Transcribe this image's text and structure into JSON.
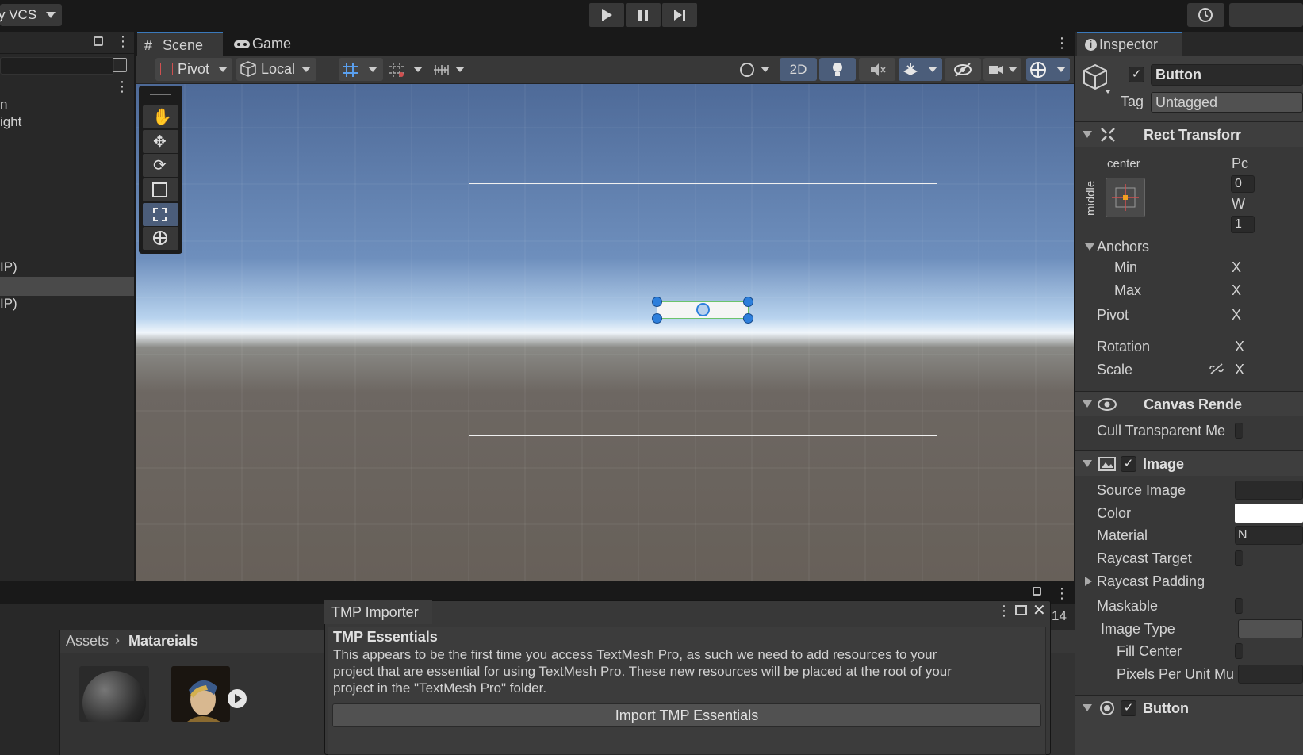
{
  "toolbar": {
    "vcs_label": "y VCS",
    "play": "play-icon",
    "pause": "pause-icon",
    "step": "step-icon"
  },
  "hierarchy": {
    "items": [
      {
        "text": "n"
      },
      {
        "text": "ight"
      },
      {
        "text": "IP)"
      },
      {
        "text": ""
      },
      {
        "text": "IP)"
      }
    ]
  },
  "scene": {
    "tabs": [
      {
        "label": "Scene",
        "icon": "hash-icon"
      },
      {
        "label": "Game",
        "icon": "gamepad-icon"
      }
    ],
    "toolbar": {
      "pivot": "Pivot",
      "local": "Local",
      "mode_2d": "2D"
    }
  },
  "inspector": {
    "tab_label": "Inspector",
    "object_name": "Button",
    "tag_label": "Tag",
    "tag_value": "Untagged",
    "rect_transform": {
      "title": "Rect Transforr",
      "anchor_h": "center",
      "anchor_v": "middle",
      "pos_label_fragment": "Pc",
      "pos_value_fragment": "0",
      "w_label_fragment": "W",
      "w_value_fragment": "1",
      "anchors_label": "Anchors",
      "min_label": "Min",
      "max_label": "Max",
      "pivot_label": "Pivot",
      "rotation_label": "Rotation",
      "scale_label": "Scale",
      "x_label": "X"
    },
    "canvas_renderer": {
      "title": "Canvas Rende",
      "cull_label": "Cull Transparent Me"
    },
    "image": {
      "title": "Image",
      "source_image": "Source Image",
      "color": "Color",
      "material": "Material",
      "material_value_fragment": "N",
      "raycast_target": "Raycast Target",
      "raycast_padding": "Raycast Padding",
      "maskable": "Maskable",
      "image_type": "Image Type",
      "fill_center": "Fill Center",
      "pixels_per_unit": "Pixels Per Unit Mu"
    },
    "button_component": {
      "title": "Button"
    }
  },
  "project": {
    "breadcrumb": [
      "Assets",
      "Matareials"
    ],
    "count_fragment": "14"
  },
  "tmp_importer": {
    "title": "TMP Importer",
    "heading": "TMP Essentials",
    "body_line1": "This appears to be the first time you access TextMesh Pro, as such we need to add resources to your",
    "body_line2": "project that are essential for using TextMesh Pro. These new resources will be placed at the root of your",
    "body_line3": "project in the \"TextMesh Pro\" folder.",
    "import_button": "Import TMP Essentials"
  },
  "colors": {
    "accent": "#3a79bb",
    "handle": "#2d7fdc",
    "panel": "#383838",
    "background": "#191919"
  }
}
